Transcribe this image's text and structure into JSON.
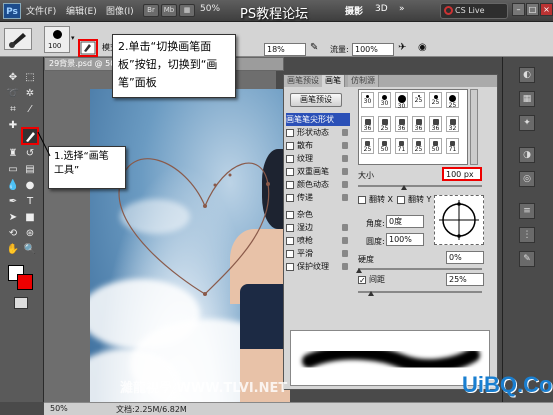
{
  "menubar": {
    "logo": "Ps",
    "items": [
      "文件(F)",
      "编辑(E)",
      "图像(I)"
    ],
    "zoom": "50%",
    "overlay_title": "PS教程论坛",
    "right_label": "摄影",
    "mode_3d": "3D",
    "cs_live": "CS Live"
  },
  "options_bar": {
    "brush_size": "100",
    "mode_label": "模式",
    "opacity_value": "18%",
    "flow_label": "流量:",
    "flow_value": "100%"
  },
  "document": {
    "tab_title": "29背景.psd @ 50%",
    "zoom": "50%",
    "doc_info": "文档:2.25M/6.82M"
  },
  "callouts": {
    "step1": "1.选择“画笔工具”",
    "step1_line1": "1.选择“画笔",
    "step1_line2": "工具”",
    "step2_line1": "2.单击“切换画笔面",
    "step2_line2": "板”按钮，切换到“画",
    "step2_line3": "笔”面板"
  },
  "brush_panel": {
    "tabs": [
      "画笔预设",
      "画笔",
      "仿制源"
    ],
    "presets_button": "画笔预设",
    "options": [
      {
        "label": "画笔笔尖形状",
        "checked": false,
        "selected": true
      },
      {
        "label": "形状动态",
        "checked": false
      },
      {
        "label": "散布",
        "checked": false
      },
      {
        "label": "纹理",
        "checked": false
      },
      {
        "label": "双重画笔",
        "checked": false
      },
      {
        "label": "颜色动态",
        "checked": false
      },
      {
        "label": "传递",
        "checked": false
      },
      {
        "label": "杂色",
        "checked": false
      },
      {
        "label": "湿边",
        "checked": false
      },
      {
        "label": "喷枪",
        "checked": false
      },
      {
        "label": "平滑",
        "checked": false
      },
      {
        "label": "保护纹理",
        "checked": false
      }
    ],
    "tips_row1": [
      "30",
      "30",
      "30",
      "25",
      "25",
      "25"
    ],
    "tips_row2": [
      "36",
      "25",
      "36",
      "36",
      "36",
      "32"
    ],
    "tips_row3": [
      "25",
      "50",
      "71",
      "25",
      "50",
      "71"
    ],
    "size_label": "大小",
    "size_value": "100 px",
    "flip_x": "翻转 X",
    "flip_y": "翻转 Y",
    "angle_label": "角度:",
    "angle_value": "0度",
    "roundness_label": "圆度:",
    "roundness_value": "100%",
    "hardness_label": "硬度",
    "hardness_value": "0%",
    "spacing_label": "间距",
    "spacing_checked": true,
    "spacing_value": "25%"
  },
  "watermarks": {
    "bottom_left": "濰龍視學 WWW.TLVI.NET",
    "bottom_right": "UiBQ.CoM"
  },
  "colors": {
    "accent_red": "#e00000",
    "selected_blue": "#2b50b7",
    "watermark_blue": "#1a7fd0"
  }
}
